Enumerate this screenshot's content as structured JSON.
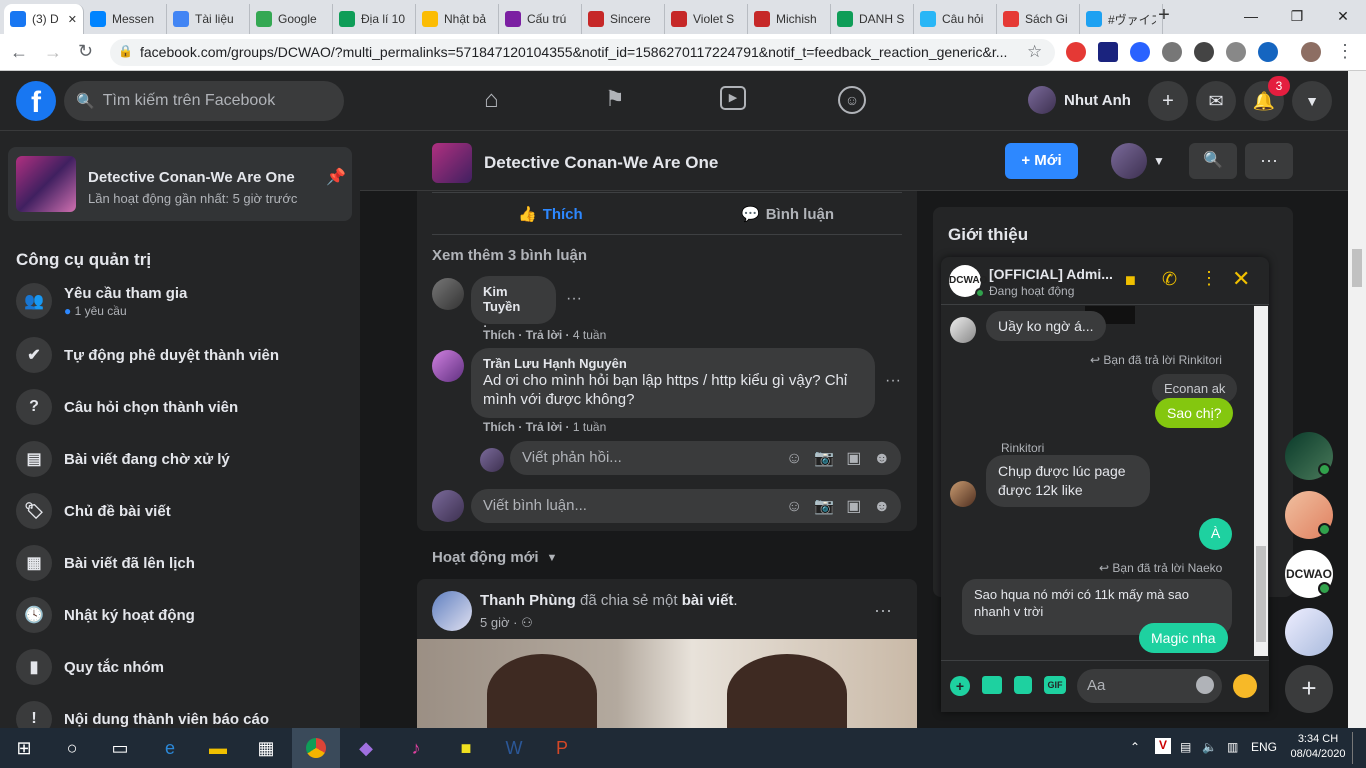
{
  "browser": {
    "tabs": [
      {
        "label": "(3) D",
        "color": "#1877f2",
        "active": true
      },
      {
        "label": "Messen",
        "color": "#0084ff"
      },
      {
        "label": "Tài liệu",
        "color": "#4285f4"
      },
      {
        "label": "Google",
        "color": "#34a853"
      },
      {
        "label": "Địa lí 10",
        "color": "#0f9d58"
      },
      {
        "label": "Nhật bả",
        "color": "#fbbc04"
      },
      {
        "label": "Cấu trú",
        "color": "#7b1fa2"
      },
      {
        "label": "Sincere",
        "color": "#c62828"
      },
      {
        "label": "Violet S",
        "color": "#c62828"
      },
      {
        "label": "Michish",
        "color": "#c62828"
      },
      {
        "label": "DANH S",
        "color": "#0f9d58"
      },
      {
        "label": "Câu hỏi",
        "color": "#29b6f6"
      },
      {
        "label": "Sách Gi",
        "color": "#e53935"
      },
      {
        "label": "#ヴァイス",
        "color": "#1da1f2"
      }
    ],
    "url": "facebook.com/groups/DCWAO/?multi_permalinks=571847120104355&notif_id=1586270117224791&notif_t=feedback_reaction_generic&r..."
  },
  "fb": {
    "search_placeholder": "Tìm kiếm trên Facebook",
    "user_name": "Nhut Anh",
    "notif_count": "3"
  },
  "sidebar": {
    "group_name": "Detective Conan-We Are One",
    "group_activity": "Lần hoạt động gần nhất: 5 giờ trước",
    "section_title": "Công cụ quản trị",
    "items": [
      {
        "label": "Yêu cầu tham gia",
        "sub": "1 yêu cầu",
        "icon": "👥"
      },
      {
        "label": "Tự động phê duyệt thành viên",
        "icon": "✔"
      },
      {
        "label": "Câu hỏi chọn thành viên",
        "icon": "?"
      },
      {
        "label": "Bài viết đang chờ xử lý",
        "icon": "▤"
      },
      {
        "label": "Chủ đề bài viết",
        "icon": "🏷"
      },
      {
        "label": "Bài viết đã lên lịch",
        "icon": "▦"
      },
      {
        "label": "Nhật ký hoạt động",
        "icon": "🕓"
      },
      {
        "label": "Quy tắc nhóm",
        "icon": "▮"
      },
      {
        "label": "Nội dung thành viên báo cáo",
        "icon": "!"
      }
    ]
  },
  "group_header": {
    "title": "Detective Conan-We Are One",
    "new_button": "+ Mới"
  },
  "post": {
    "like_label": "Thích",
    "comment_label": "Bình luận",
    "more_comments": "Xem thêm 3 bình luận",
    "comments": [
      {
        "author": "Kim Tuyền",
        "text": ".",
        "meta_like": "Thích",
        "meta_reply": "Trả lời",
        "meta_time": "4 tuần"
      },
      {
        "author": "Trần Lưu Hạnh Nguyên",
        "text": "Ad ơi cho mình hỏi bạn lập https / http kiểu gì vậy? Chỉ mình với được không?",
        "meta_like": "Thích",
        "meta_reply": "Trả lời",
        "meta_time": "1 tuần"
      }
    ],
    "reply_placeholder": "Viết phản hồi...",
    "comment_placeholder": "Viết bình luận..."
  },
  "feed": {
    "recent_label": "Hoạt động mới",
    "next_post": {
      "author": "Thanh Phùng",
      "action": "đã chia sẻ một",
      "object": "bài viết",
      "time": "5 giờ"
    }
  },
  "intro_title": "Giới thiệu",
  "messenger": {
    "title": "[OFFICIAL] Admi...",
    "status": "Đang hoạt động",
    "messages": {
      "m1": "Uầy ko ngờ á...",
      "reply1": "Bạn đã trả lời Rinkitori",
      "quote1": "Econan ak",
      "m2": "Sao chị?",
      "name_rinkitori": "Rinkitori",
      "m3": "Chụp được lúc page được 12k like",
      "m4": "À",
      "reply2": "Bạn đã trả lời Naeko",
      "quote2": "Sao hqua nó mới có 11k mấy mà sao nhanh v trời",
      "m5": "Magic nha"
    },
    "input_placeholder": "Aa"
  },
  "taskbar": {
    "lang": "ENG",
    "time": "3:34 CH",
    "date": "08/04/2020"
  }
}
